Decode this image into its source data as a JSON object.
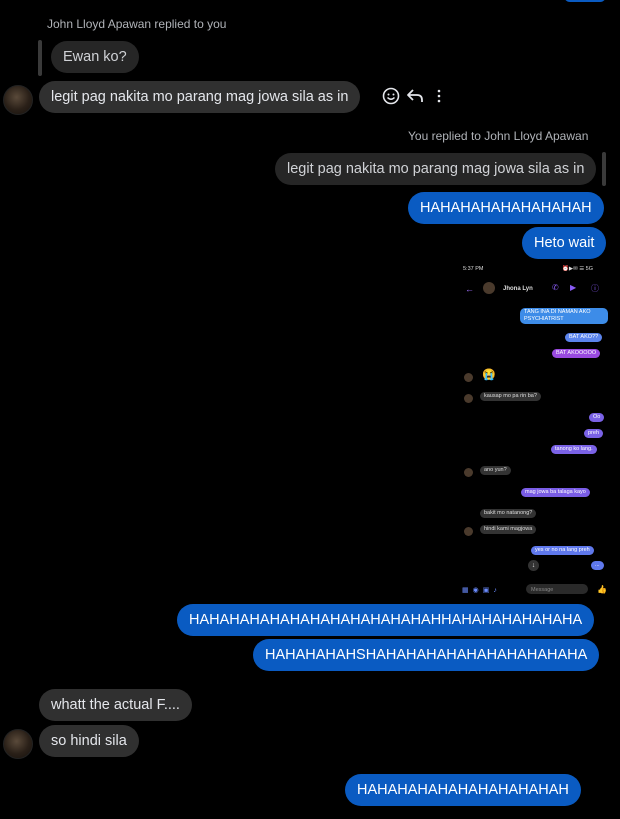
{
  "reply_header_1": "John Lloyd Apawan replied to you",
  "quoted_1": "Ewan ko?",
  "msg_in_1": "legit pag nakita mo parang mag jowa sila as in",
  "reply_header_2": "You replied to John Lloyd Apawan",
  "quoted_2": "legit pag nakita mo parang mag jowa sila as in",
  "msg_out_1": "HAHAHAHAHAHAHAHAH",
  "msg_out_2": "Heto wait",
  "msg_out_3": "HAHAHAHAHAHAHAHAHAHAHAHAHHAHAHAHAHAHAHA",
  "msg_out_4": "HAHAHAHAHSHAHAHAHAHAHAHAHAHAHAHA",
  "msg_in_2": "whatt the actual F....",
  "msg_in_3": "so hindi sila",
  "msg_out_5": "HAHAHAHAHAHAHAHAHAHAH",
  "shared_screenshot": {
    "time": "5:37 PM",
    "status_icons": "⏰▶✉ ☰ 5G",
    "contact_name": "Jhona Lyn",
    "messages": [
      {
        "side": "out",
        "text": "TANG INA DI NAMAN AKO PSYCHIATRIST",
        "color": "#3d8ce8"
      },
      {
        "side": "out",
        "text": "BAT AKO??",
        "color": "#5b84ec"
      },
      {
        "side": "out",
        "text": "BAT AKOOOOO",
        "color": "#9a4ae0"
      },
      {
        "side": "in",
        "text": "😭"
      },
      {
        "side": "in",
        "text": "kausap mo pa rin ba?"
      },
      {
        "side": "out",
        "text": "Oo",
        "color": "#7a62e6"
      },
      {
        "side": "out",
        "text": "preh",
        "color": "#7a62e6"
      },
      {
        "side": "out",
        "text": "tanong ko lang.",
        "color": "#7a62e6"
      },
      {
        "side": "in",
        "text": "ano yun?"
      },
      {
        "side": "out",
        "text": "mag jowa ba talaga kayo",
        "color": "#7a5de6"
      },
      {
        "side": "in",
        "text": "bakit mo natanong?"
      },
      {
        "side": "in",
        "text": "hindi kami magjowa"
      },
      {
        "side": "out",
        "text": "yes or no na lang preh",
        "color": "#5f78ec"
      },
      {
        "side": "out",
        "text": "...",
        "color": "#5f78ec"
      }
    ],
    "composer_placeholder": "Message"
  }
}
